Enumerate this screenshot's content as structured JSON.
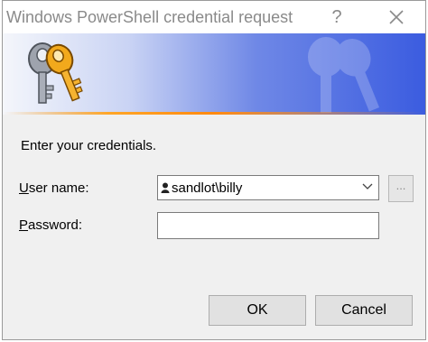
{
  "window": {
    "title": "Windows PowerShell credential request",
    "help_glyph": "?",
    "close_icon": "close-icon"
  },
  "banner": {
    "icon": "keys-icon",
    "colors": {
      "start": "#f4f6fb",
      "end": "#3b5ce0",
      "accent": "#ff8a10"
    }
  },
  "form": {
    "prompt": "Enter your credentials.",
    "user_label_prefix": "U",
    "user_label_rest": "ser name:",
    "password_label_prefix": "P",
    "password_label_rest": "assword:",
    "user_value": "sandlot\\billy",
    "password_value": "",
    "browse_label": "..."
  },
  "buttons": {
    "ok": "OK",
    "cancel": "Cancel"
  }
}
